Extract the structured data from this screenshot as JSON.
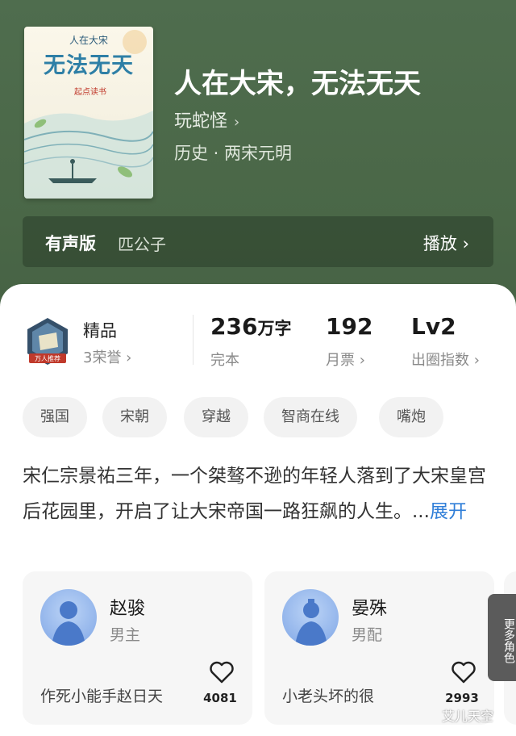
{
  "book": {
    "cover_subtitle": "人在大宋",
    "cover_title": "无法无天",
    "cover_brand": "起点读书",
    "title": "人在大宋，无法无天",
    "author": "玩蛇怪",
    "author_chevron": "›",
    "genre": "历史 · 两宋元明"
  },
  "audio": {
    "label": "有声版",
    "narrator": "匹公子",
    "play_label": "播放 ›"
  },
  "stats": {
    "badge_name": "精品",
    "badge_honor": "3荣誉 ›",
    "badge_ribbon": "万人推荐",
    "words_value": "236",
    "words_unit": "万字",
    "words_label": "完本",
    "monthly_votes": "192",
    "monthly_label": "月票 ›",
    "level": "Lv2",
    "level_label": "出圈指数 ›"
  },
  "tags": [
    "强国",
    "宋朝",
    "穿越",
    "智商在线",
    "嘴炮"
  ],
  "synopsis": {
    "text": "宋仁宗景祐三年，一个桀骜不逊的年轻人落到了大宋皇宫后花园里，开启了让大宋帝国一路狂飙的人生。...",
    "more_label": "展开"
  },
  "characters": [
    {
      "name": "赵骏",
      "role": "男主",
      "desc": "作死小能手赵日天",
      "likes": "4081"
    },
    {
      "name": "晏殊",
      "role": "男配",
      "desc": "小老头坏的很",
      "likes": "2993"
    }
  ],
  "more_roles_label": "更多角色",
  "watermark": "艾儿天空",
  "icons": [
    "chevron-right-icon",
    "heart-icon",
    "honor-badge-icon"
  ]
}
